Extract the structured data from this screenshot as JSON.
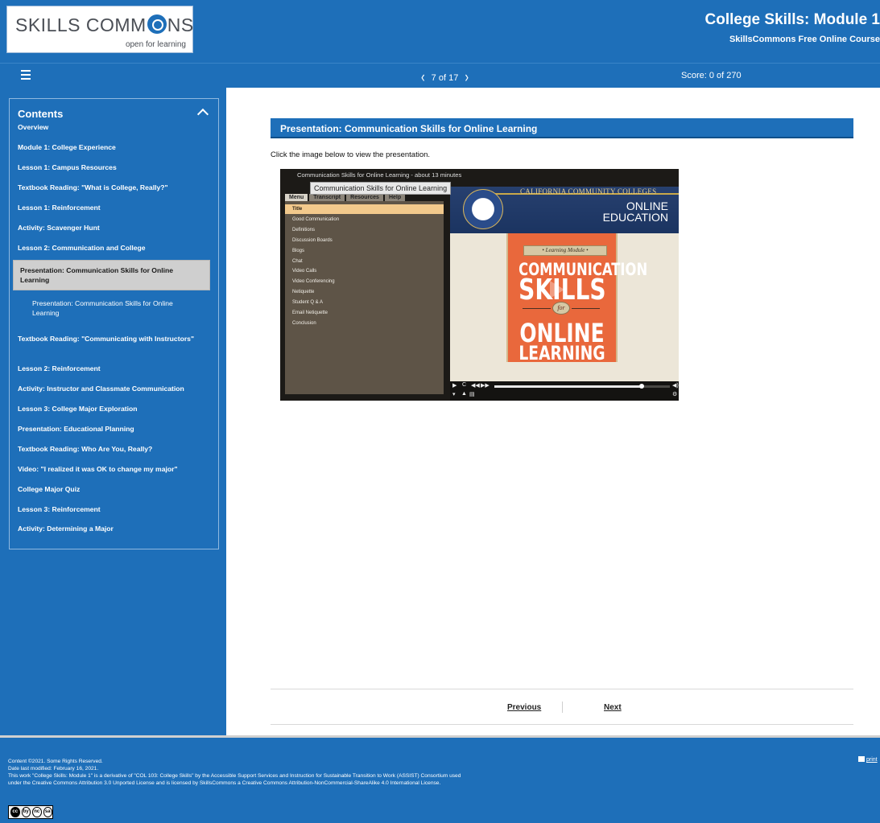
{
  "header": {
    "logo_text_a": "SKILLS COMM",
    "logo_text_b": "NS",
    "logo_tagline": "open for learning",
    "course_title": "College Skills: Module 1",
    "course_subtitle": "SkillsCommons Free Online Course"
  },
  "nav": {
    "prev_icon": "chevron-left-icon",
    "next_icon": "chevron-right-icon",
    "pager_text": "7 of 17",
    "score_text": "Score: 0 of 270"
  },
  "sidebar": {
    "title": "Contents",
    "items": [
      {
        "label": "Overview",
        "state": "normal"
      },
      {
        "label": "Module 1: College Experience",
        "state": "normal"
      },
      {
        "label": "Lesson 1: Campus Resources",
        "state": "normal"
      },
      {
        "label": "Textbook Reading: \"What is College, Really?\"",
        "state": "normal"
      },
      {
        "label": "Lesson 1: Reinforcement",
        "state": "normal"
      },
      {
        "label": "Activity: Scavenger Hunt",
        "state": "normal"
      },
      {
        "label": "Lesson 2: Communication and College",
        "state": "normal"
      },
      {
        "label": "Presentation: Communication Skills for Online Learning",
        "state": "active"
      },
      {
        "label": "Presentation: Communication Skills for Online Learning",
        "state": "sub"
      },
      {
        "label": "Textbook Reading: \"Communicating with Instructors\"",
        "state": "normal"
      },
      {
        "label": "Lesson 2: Reinforcement",
        "state": "normal"
      },
      {
        "label": "Activity: Instructor and Classmate Communication",
        "state": "normal"
      },
      {
        "label": "Lesson 3: College Major Exploration",
        "state": "normal"
      },
      {
        "label": "Presentation: Educational Planning",
        "state": "normal"
      },
      {
        "label": "Textbook Reading: Who Are You, Really?",
        "state": "normal"
      },
      {
        "label": "Video: \"I realized it was OK to change my major\"",
        "state": "normal"
      },
      {
        "label": "College Major Quiz",
        "state": "normal"
      },
      {
        "label": "Lesson 3: Reinforcement",
        "state": "normal"
      },
      {
        "label": "Activity: Determining a Major",
        "state": "normal"
      }
    ]
  },
  "main": {
    "heading": "Presentation: Communication Skills for Online Learning",
    "instruction": "Click the image below to view the presentation."
  },
  "player": {
    "title": "Communication Skills for Online Learning - about 13 minutes",
    "tabs": [
      "Menu",
      "Transcript",
      "Resources",
      "Help"
    ],
    "tooltip": "Communication Skills for Online Learning",
    "menu_items": [
      "Title",
      "Good Communication",
      "Definitions",
      "Discussion Boards",
      "Blogs",
      "Chat",
      "Video Calls",
      "Video Conferencing",
      "Netiquette",
      "Student Q & A",
      "Email Netiquette",
      "Conclusion"
    ],
    "active_menu_index": 0,
    "slide": {
      "banner_text": "CALIFORNIA COMMUNITY COLLEGES",
      "online": "ONLINE",
      "education": "EDUCATION",
      "ribbon": "• Learning Module •",
      "word1": "COMMUNICATION",
      "word2": "SKILLS",
      "word3": "for",
      "word4": "ONLINE",
      "word5": "LEARNING"
    },
    "controls": {
      "play": "▶",
      "replay": "C",
      "rewind": "◀◀",
      "forward": "▶▶",
      "volume": "◀)",
      "captions": "▾",
      "up": "▲",
      "cc": "▤",
      "settings": "⚙"
    },
    "progress": 0.84
  },
  "pagination": {
    "previous": "Previous",
    "next": "Next"
  },
  "footer": {
    "line1": "Content ©2021. Some Rights Reserved.",
    "line2": "Date last modified: February 16, 2021.",
    "line3": "This work \"College Skills: Module 1\" is a derivative of \"COL 103: College Skills\" by the Accessible Support Services and Instruction for Sustainable Transition to Work (ASSIST) Consortium used",
    "line4": "under the Creative Commons Attribution 3.0 Unported License and is licensed by SkillsCommons a Creative Commons Attribution-NonCommercial-ShareAlike 4.0 International License.",
    "print_label": "print",
    "cc_icons": [
      "cc",
      "by",
      "nc",
      "sa"
    ]
  },
  "colors": {
    "brand_blue": "#1e6fb9",
    "active_item_bg": "#cfcfcf",
    "slide_orange": "#e9683c"
  }
}
